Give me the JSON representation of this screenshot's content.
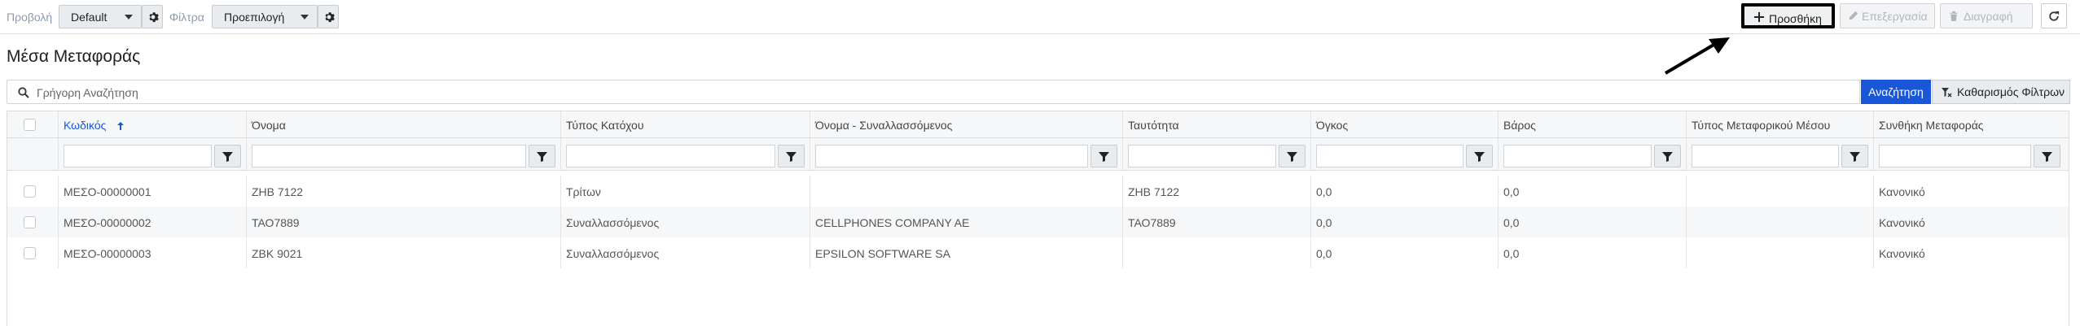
{
  "toolbar": {
    "view_label": "Προβολή",
    "view_value": "Default",
    "filter_label": "Φίλτρα",
    "filter_value": "Προεπιλογή",
    "add_label": "Προσθήκη",
    "edit_label": "Επεξεργασία",
    "delete_label": "Διαγραφή"
  },
  "page": {
    "title": "Μέσα Μεταφοράς"
  },
  "search": {
    "placeholder": "Γρήγορη Αναζήτηση",
    "search_button": "Αναζήτηση",
    "clear_button": "Καθαρισμός Φίλτρων"
  },
  "colors": {
    "accent": "#1a57d8",
    "link": "#1a57d8"
  },
  "table": {
    "sort": {
      "column": "Κωδικός",
      "direction": "ascending"
    },
    "columns": [
      "Κωδικός",
      "Όνομα",
      "Τύπος Κατόχου",
      "Όνομα - Συναλλασσόμενος",
      "Ταυτότητα",
      "Όγκος",
      "Βάρος",
      "Τύπος Μεταφορικού Μέσου",
      "Συνθήκη Μεταφοράς"
    ],
    "rows": [
      [
        "ΜΕΣΟ-00000001",
        "ΖΗΒ 7122",
        "Τρίτων",
        "",
        "ΖΗΒ 7122",
        "0,0",
        "0,0",
        "",
        "Κανονικό"
      ],
      [
        "ΜΕΣΟ-00000002",
        "ΤΑΟ7889",
        "Συναλλασσόμενος",
        "CELLPHONES COMPANY AE",
        "ΤΑΟ7889",
        "0,0",
        "0,0",
        "",
        "Κανονικό"
      ],
      [
        "ΜΕΣΟ-00000003",
        "ΖΒΚ 9021",
        "Συναλλασσόμενος",
        "EPSILON SOFTWARE SA",
        "",
        "0,0",
        "0,0",
        "",
        "Κανονικό"
      ]
    ]
  }
}
